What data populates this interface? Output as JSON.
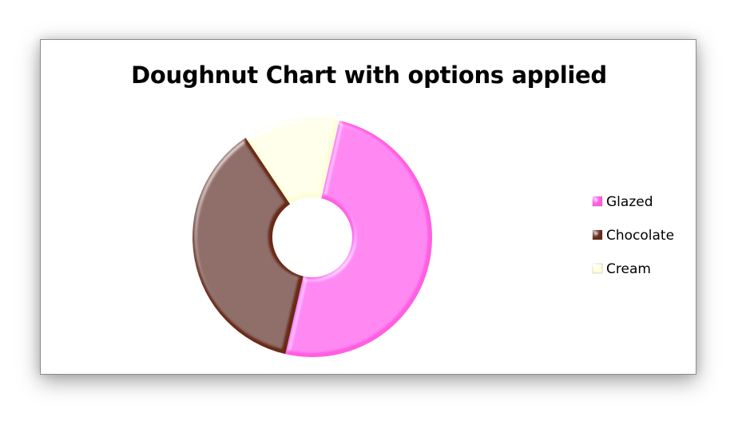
{
  "chart_data": {
    "type": "pie",
    "variant": "doughnut",
    "title": "Doughnut Chart with options applied",
    "categories": [
      "Glazed",
      "Chocolate",
      "Cream"
    ],
    "values": [
      50,
      37,
      13
    ],
    "colors": [
      "#FF5FE2",
      "#6B2A14",
      "#FCFDD9"
    ],
    "start_angle_deg": 13,
    "legend_position": "right"
  }
}
